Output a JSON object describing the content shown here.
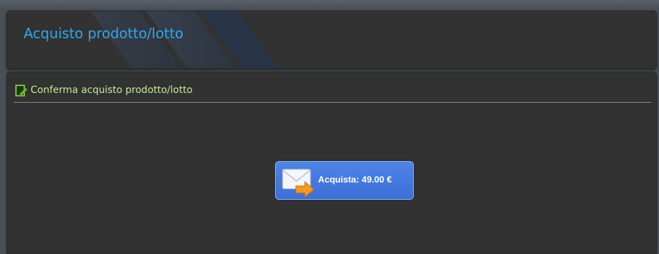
{
  "header": {
    "title": "Acquisto prodotto/lotto"
  },
  "section": {
    "title": "Conferma acquisto prodotto/lotto",
    "icon": "edit-document-icon"
  },
  "buy_button": {
    "label": "Acquista: 49.00 €",
    "icon": "mail-send-icon"
  },
  "colors": {
    "background": "#4a5058",
    "panel": "#323232",
    "title_blue": "#2ea7ef",
    "section_green": "#c6e89a",
    "button_blue": "#4478e0"
  }
}
